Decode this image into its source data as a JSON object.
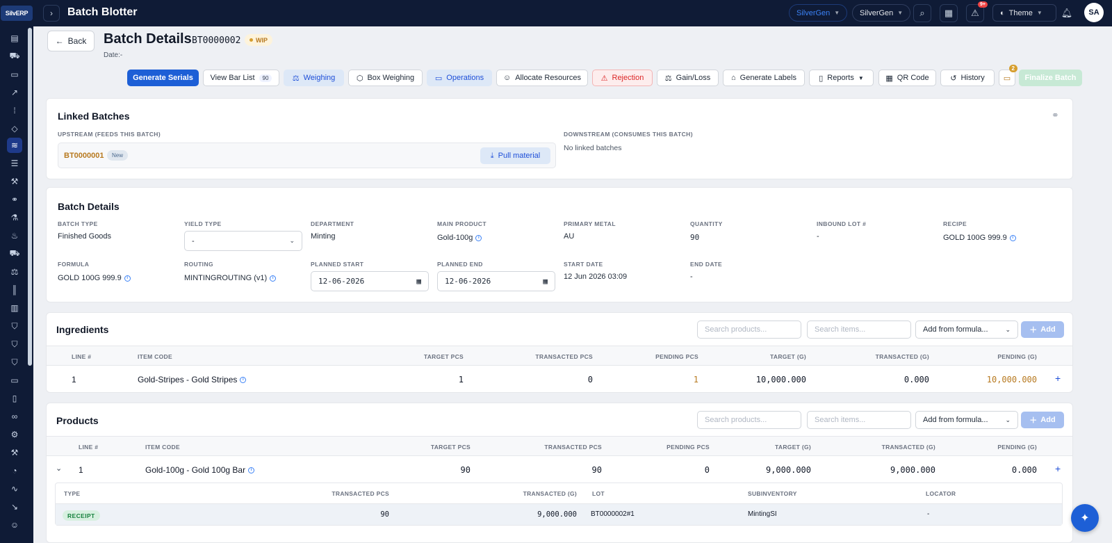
{
  "header": {
    "logo_text": "SilvERP",
    "title": "Batch Blotter",
    "org_pill_1": "SilverGen",
    "org_pill_2": "SilverGen",
    "notifications_badge": "9+",
    "theme_label": "Theme",
    "avatar_initials": "SA"
  },
  "page": {
    "back_label": "Back",
    "title": "Batch Details",
    "batch_code": "BT0000002",
    "status": "WIP",
    "date_line": "Date:-"
  },
  "toolbar": {
    "generate_serials": "Generate Serials",
    "view_bar_list": "View Bar List",
    "bar_count": "90",
    "weighing": "Weighing",
    "box_weighing": "Box Weighing",
    "operations": "Operations",
    "allocate_resources": "Allocate Resources",
    "rejection": "Rejection",
    "gain_loss": "Gain/Loss",
    "generate_labels": "Generate Labels",
    "reports": "Reports",
    "qr_code": "QR Code",
    "history": "History",
    "clipboard_badge": "2",
    "finalize_batch": "Finalize Batch"
  },
  "linked": {
    "title": "Linked Batches",
    "upstream_label": "UPSTREAM (FEEDS THIS BATCH)",
    "upstream_code": "BT0000001",
    "upstream_status": "New",
    "pull_material": "Pull material",
    "downstream_label": "DOWNSTREAM (CONSUMES THIS BATCH)",
    "downstream_value": "No linked batches"
  },
  "details": {
    "title": "Batch Details",
    "batch_type_label": "BATCH TYPE",
    "batch_type": "Finished Goods",
    "yield_type_label": "YIELD TYPE",
    "yield_type": "-",
    "department_label": "DEPARTMENT",
    "department": "Minting",
    "main_product_label": "MAIN PRODUCT",
    "main_product": "Gold-100g",
    "primary_metal_label": "PRIMARY METAL",
    "primary_metal": "AU",
    "quantity_label": "QUANTITY",
    "quantity": "90",
    "inbound_lot_label": "INBOUND LOT #",
    "inbound_lot": "-",
    "recipe_label": "RECIPE",
    "recipe": "GOLD 100G 999.9",
    "formula_label": "FORMULA",
    "formula": "GOLD 100G 999.9",
    "routing_label": "ROUTING",
    "routing": "MINTINGROUTING (v1)",
    "planned_start_label": "PLANNED START",
    "planned_start": "12-06-2026",
    "planned_end_label": "PLANNED END",
    "planned_end": "12-06-2026",
    "start_date_label": "START DATE",
    "start_date": "12 Jun 2026 03:09",
    "end_date_label": "END DATE",
    "end_date": "-"
  },
  "ingredients": {
    "title": "Ingredients",
    "search_products": "Search products...",
    "search_items": "Search items...",
    "add_from_formula": "Add from formula...",
    "add": "Add",
    "columns": [
      "LINE #",
      "ITEM CODE",
      "TARGET PCS",
      "TRANSACTED PCS",
      "PENDING PCS",
      "TARGET (G)",
      "TRANSACTED (G)",
      "PENDING (G)"
    ],
    "rows": [
      {
        "line": "1",
        "item": "Gold-Stripes - Gold Stripes",
        "target_pcs": "1",
        "transacted_pcs": "0",
        "pending_pcs": "1",
        "target_g": "10,000.000",
        "transacted_g": "0.000",
        "pending_g": "10,000.000"
      }
    ]
  },
  "products": {
    "title": "Products",
    "search_products": "Search products...",
    "search_items": "Search items...",
    "add_from_formula": "Add from formula...",
    "add": "Add",
    "columns": [
      "LINE #",
      "ITEM CODE",
      "TARGET PCS",
      "TRANSACTED PCS",
      "PENDING PCS",
      "TARGET (G)",
      "TRANSACTED (G)",
      "PENDING (G)"
    ],
    "rows": [
      {
        "line": "1",
        "item": "Gold-100g - Gold 100g Bar",
        "target_pcs": "90",
        "transacted_pcs": "90",
        "pending_pcs": "0",
        "target_g": "9,000.000",
        "transacted_g": "9,000.000",
        "pending_g": "0.000"
      }
    ],
    "sub_columns": [
      "TYPE",
      "TRANSACTED PCS",
      "TRANSACTED (G)",
      "LOT",
      "SUBINVENTORY",
      "LOCATOR"
    ],
    "sub_rows": [
      {
        "type": "RECEIPT",
        "transacted_pcs": "90",
        "transacted_g": "9,000.000",
        "lot": "BT0000002#1",
        "subinventory": "MintingSI",
        "locator": "-"
      }
    ]
  },
  "colors": {
    "nav_bg": "#0f1b36",
    "primary": "#1d5fd6",
    "accent_gold": "#b7791f",
    "danger": "#dc2626",
    "success": "#15803d"
  }
}
